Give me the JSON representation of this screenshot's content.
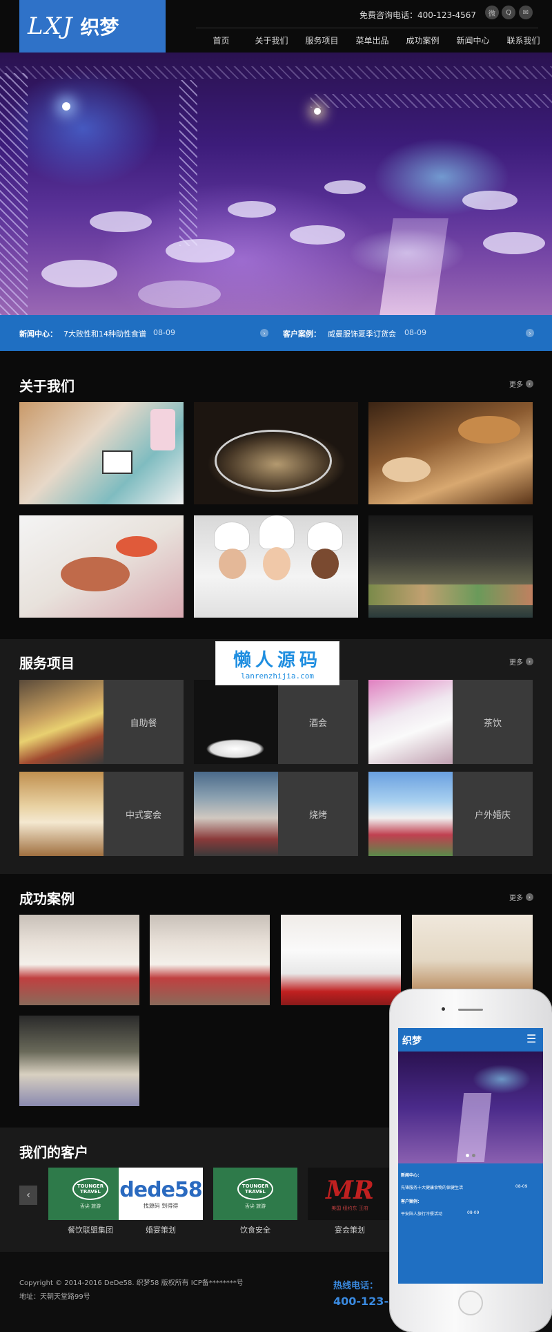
{
  "header": {
    "logo_script": "LXJ",
    "logo_cn": "织梦",
    "hotline": "免费咨询电话：400-123-4567",
    "social_icons": [
      "weibo-icon",
      "qq-icon",
      "mail-icon"
    ],
    "nav": [
      "首页",
      "关于我们",
      "服务项目",
      "菜单出品",
      "成功案例",
      "新闻中心",
      "联系我们"
    ]
  },
  "newsbar": {
    "news_label": "新闻中心：",
    "news_title": "7大败性和14种助性食谱",
    "news_date": "08-09",
    "case_label": "客户案例：",
    "case_title": "威曼服饰夏季订货会",
    "case_date": "08-09"
  },
  "about": {
    "title": "关于我们",
    "more": "更多"
  },
  "services": {
    "title": "服务项目",
    "more": "更多",
    "items": [
      "自助餐",
      "酒会",
      "茶饮",
      "中式宴会",
      "烧烤",
      "户外婚庆"
    ]
  },
  "cases": {
    "title": "成功案例",
    "more": "更多"
  },
  "clients": {
    "title": "我们的客户",
    "items": [
      {
        "label": "餐饮联盟集团",
        "logo": "TOUNGER TRAVEL",
        "sub": "舌尖 旅游"
      },
      {
        "label": "婚宴策划",
        "logo": "dede58",
        "sub": "找源码  到得得"
      },
      {
        "label": "饮食安全",
        "logo": "TOUNGER TRAVEL",
        "sub": "舌尖 旅游"
      },
      {
        "label": "宴会策划",
        "logo": "MR",
        "sub": "美国 纽约东 王府"
      }
    ]
  },
  "footer": {
    "copyright": "Copyright © 2014-2016 DeDe58. 织梦58 版权所有  ICP备********号",
    "address": "地址：天朝天堂路99号",
    "hotline_label": "热线电话：",
    "hotline_number": "400-123-4"
  },
  "watermark": {
    "title": "懒人源码",
    "url": "lanrenzhijia.com"
  },
  "phone": {
    "logo": "织梦",
    "menu_icon": "☰",
    "news_label": "新闻中心：",
    "news_line": "先锋服务十大健康食物的保健生活",
    "news_date": "08-09",
    "case_label": "客户案例：",
    "case_line": "平安陆人旅行冷餐活动",
    "case_date": "08-09"
  },
  "colors": {
    "accent": "#1f6fc2",
    "logo_bg": "#2f72c8",
    "bg": "#0b0b0b",
    "section_alt": "#1a1a1a"
  }
}
